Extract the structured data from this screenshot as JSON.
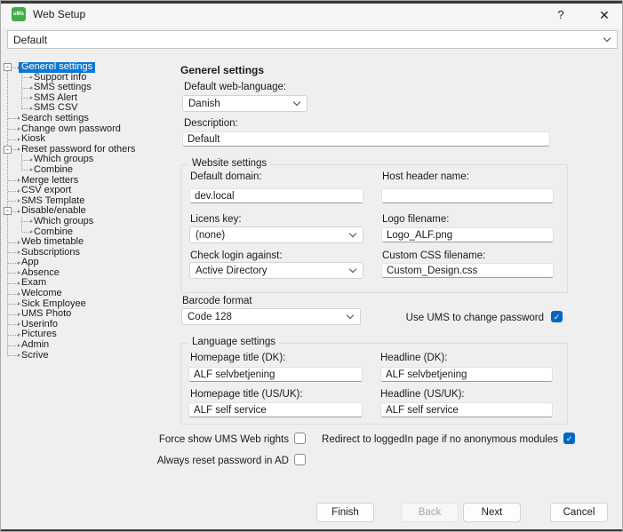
{
  "window": {
    "title": "Web Setup",
    "icon_text": "uMs",
    "help_label": "?",
    "close_label": "✕"
  },
  "profile_select": {
    "value": "Default"
  },
  "colors": {
    "accent_checkbox": "#0067c0",
    "tree_selection": "#0a78d4",
    "app_icon_green": "#3fae49"
  },
  "tree": {
    "items": [
      {
        "label": "Generel settings",
        "level": 0,
        "expandable": true,
        "selected": true
      },
      {
        "label": "Support info",
        "level": 1
      },
      {
        "label": "SMS settings",
        "level": 1
      },
      {
        "label": "SMS Alert",
        "level": 1
      },
      {
        "label": "SMS CSV",
        "level": 1
      },
      {
        "label": "Search settings",
        "level": 0
      },
      {
        "label": "Change own password",
        "level": 0
      },
      {
        "label": "Kiosk",
        "level": 0
      },
      {
        "label": "Reset password for others",
        "level": 0,
        "expandable": true
      },
      {
        "label": "Which groups",
        "level": 1
      },
      {
        "label": "Combine",
        "level": 1
      },
      {
        "label": "Merge letters",
        "level": 0
      },
      {
        "label": "CSV export",
        "level": 0
      },
      {
        "label": "SMS Template",
        "level": 0
      },
      {
        "label": "Disable/enable",
        "level": 0,
        "expandable": true
      },
      {
        "label": "Which groups",
        "level": 1
      },
      {
        "label": "Combine",
        "level": 1
      },
      {
        "label": "Web timetable",
        "level": 0
      },
      {
        "label": "Subscriptions",
        "level": 0
      },
      {
        "label": "App",
        "level": 0
      },
      {
        "label": "Absence",
        "level": 0
      },
      {
        "label": "Exam",
        "level": 0
      },
      {
        "label": "Welcome",
        "level": 0
      },
      {
        "label": "Sick Employee",
        "level": 0
      },
      {
        "label": "UMS Photo",
        "level": 0
      },
      {
        "label": "Userinfo",
        "level": 0
      },
      {
        "label": "Pictures",
        "level": 0
      },
      {
        "label": "Admin",
        "level": 0
      },
      {
        "label": "Scrive",
        "level": 0
      }
    ]
  },
  "form": {
    "heading": "Generel settings",
    "default_web_language": {
      "label": "Default web-language:",
      "value": "Danish"
    },
    "description": {
      "label": "Description:",
      "value": "Default"
    },
    "website_settings": {
      "title": "Website settings",
      "default_domain": {
        "label": "Default domain:",
        "value": "dev.local"
      },
      "host_header_name": {
        "label": "Host header name:",
        "value": ""
      },
      "licens_key": {
        "label": "Licens key:",
        "value": "(none)"
      },
      "logo_filename": {
        "label": "Logo filename:",
        "value": "Logo_ALF.png"
      },
      "check_login_against": {
        "label": "Check login against:",
        "value": "Active Directory"
      },
      "custom_css_filename": {
        "label": "Custom CSS filename:",
        "value": "Custom_Design.css"
      }
    },
    "barcode_format": {
      "label": "Barcode format",
      "value": "Code 128"
    },
    "use_ums_to_change_password": {
      "label": "Use UMS to change password",
      "checked": true
    },
    "language_settings": {
      "title": "Language settings",
      "homepage_title_dk": {
        "label": "Homepage title (DK):",
        "value": "ALF selvbetjening"
      },
      "headline_dk": {
        "label": "Headline (DK):",
        "value": "ALF selvbetjening"
      },
      "homepage_title_usuk": {
        "label": "Homepage title (US/UK):",
        "value": "ALF self service"
      },
      "headline_usuk": {
        "label": "Headline (US/UK):",
        "value": "ALF self service"
      }
    },
    "force_show_ums_web_rights": {
      "label": "Force show UMS Web rights",
      "checked": false
    },
    "redirect_to_loggedin": {
      "label": "Redirect to loggedIn page if no anonymous modules",
      "checked": true
    },
    "always_reset_password_in_ad": {
      "label": "Always reset password in AD",
      "checked": false
    }
  },
  "footer": {
    "finish": {
      "label": "Finish",
      "enabled": true
    },
    "back": {
      "label": "Back",
      "enabled": false
    },
    "next": {
      "label": "Next",
      "enabled": true
    },
    "cancel": {
      "label": "Cancel",
      "enabled": true
    }
  }
}
